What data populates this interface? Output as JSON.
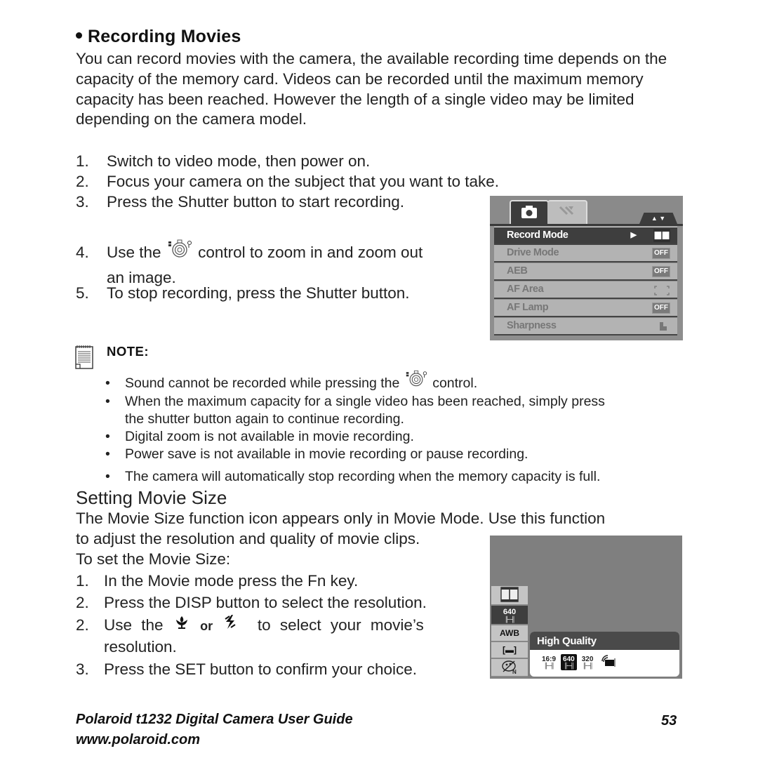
{
  "section1": {
    "title": "Recording Movies",
    "intro": "You can record movies with the camera, the available recording time depends on the capacity of the memory card. Videos can be recorded until the maximum memory capacity has been reached. However the length of a single video may be limited depending on the camera model.",
    "steps": [
      {
        "num": "1.",
        "text": "Switch to video mode, then power on."
      },
      {
        "num": "2.",
        "text": "Focus your camera on the subject that you want to take."
      },
      {
        "num": "3.",
        "text": "Press the Shutter button to start recording."
      },
      {
        "num": "4.",
        "text_before": "Use the",
        "text_after": "control to zoom in and zoom out an image.",
        "icon": "zoom-control-icon"
      },
      {
        "num": "5.",
        "text": "To stop recording, press the Shutter button."
      }
    ]
  },
  "camera_menu": {
    "tabs": [
      {
        "icon": "camera-icon"
      },
      {
        "icon": "settings-tools-icon"
      }
    ],
    "scroll_arrows": "▲ ▼",
    "rows": [
      {
        "label": "Record Mode",
        "value_icon": "film-icon",
        "selected": true,
        "arrow": "▶"
      },
      {
        "label": "Drive Mode",
        "value": "OFF"
      },
      {
        "label": "AEB",
        "value": "OFF"
      },
      {
        "label": "AF Area",
        "value_icon": "af-area-bracket-icon"
      },
      {
        "label": "AF Lamp",
        "value": "OFF"
      },
      {
        "label": "Sharpness",
        "value_icon": "sharpness-icon"
      }
    ]
  },
  "note": {
    "label": "NOTE:",
    "bullets": [
      {
        "text_before": "Sound cannot be recorded while pressing the",
        "text_after": "control.",
        "icon": "zoom-control-icon"
      },
      {
        "line1": "When the maximum capacity for a single video has been reached, simply press",
        "line2": "the shutter button again to continue recording."
      },
      {
        "text": "Digital zoom is not available in movie recording."
      },
      {
        "text": "Power save is not available in movie recording or pause recording."
      },
      {
        "text": "The camera will automatically stop recording when the memory capacity is full."
      }
    ]
  },
  "section2": {
    "title": "Setting Movie Size",
    "intro_line1": "The Movie Size function icon appears only in Movie Mode. Use this function",
    "intro_line2": "to adjust the resolution and quality of movie clips.",
    "intro_line3": "To set the Movie Size:",
    "steps": [
      {
        "num": "1.",
        "text": "In the Movie mode press the Fn key."
      },
      {
        "num": "2.",
        "text": "Press the DISP button to select the resolution."
      },
      {
        "num": "2.",
        "text_before": "Use the",
        "or": "or",
        "text_after": "to select your movie’s",
        "text_line2": "resolution.",
        "icons": [
          "macro-tulip-icon",
          "flash-icon"
        ]
      },
      {
        "num": "3.",
        "text": "Press the SET button to confirm your choice."
      }
    ]
  },
  "movie_screen": {
    "side_items": [
      {
        "icon": "film-icon"
      },
      {
        "label": "640",
        "icon": "movie-size-640-icon",
        "selected": true
      },
      {
        "label": "AWB"
      },
      {
        "label": "[▬]",
        "icon": "metering-icon"
      },
      {
        "icon": "color-mode-icon"
      }
    ],
    "panel_title": "High Quality",
    "options": [
      {
        "label": "16:9"
      },
      {
        "label": "640",
        "selected": true
      },
      {
        "label": "320"
      },
      {
        "icon": "web-stream-icon"
      }
    ]
  },
  "footer": {
    "title": "Polaroid t1232 Digital Camera User Guide",
    "url": "www.polaroid.com",
    "page": "53"
  }
}
